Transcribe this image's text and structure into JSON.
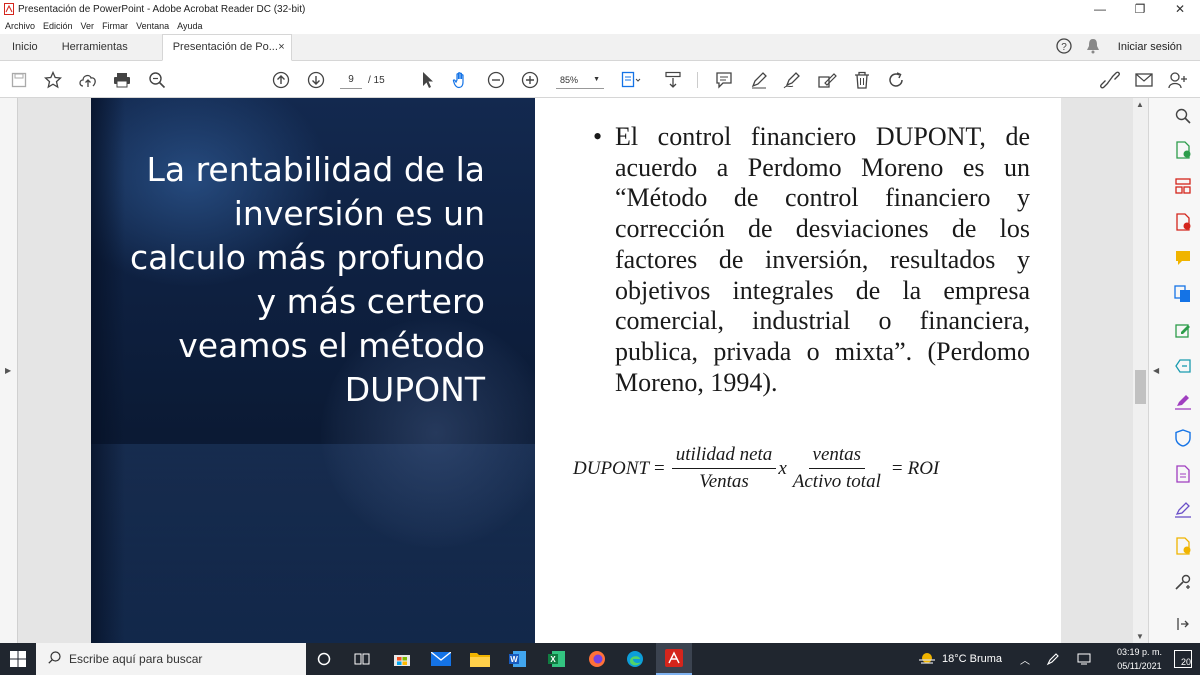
{
  "window": {
    "title": "Presentación de PowerPoint - Adobe Acrobat Reader DC (32-bit)",
    "controls": [
      "—",
      "❐",
      "✕"
    ]
  },
  "menu": [
    "Archivo",
    "Edición",
    "Ver",
    "Firmar",
    "Ventana",
    "Ayuda"
  ],
  "tabs": {
    "home": "Inicio",
    "tools": "Herramientas",
    "document": "Presentación de Po...",
    "close": "×",
    "signin": "Iniciar sesión"
  },
  "toolbar": {
    "current_page": "9",
    "page_total": "/ 15",
    "zoom": "85%"
  },
  "slide": {
    "title": "La rentabilidad de la inversión es un calculo más profundo y más certero veamos el método DUPONT",
    "bullet": "El control financiero DUPONT, de acuerdo a Perdomo Moreno es un “Método de control financiero y corrección de desviaciones de los factores de inversión, resultados y objetivos integrales de la empresa comercial, industrial o financiera, publica, privada o mixta”. (Perdomo Moreno, 1994).",
    "formula": {
      "lhs": "DUPONT",
      "eq1": "=",
      "frac1_num": "utilidad neta",
      "frac1_den": "Ventas",
      "times": "x",
      "frac2_num": "ventas",
      "frac2_den": "Activo total",
      "eq2": "=",
      "rhs": "ROI"
    }
  },
  "taskbar": {
    "search_placeholder": "Escribe aquí para buscar",
    "weather": "18°C  Bruma",
    "time": "03:19 p. m.",
    "date": "05/11/2021",
    "notifications": "20"
  },
  "colors": {
    "slide_dark": "#0e2040",
    "taskbar": "#20262f",
    "acrobat_red": "#d4251c",
    "right_pane_icon_blue": "#1473e6"
  }
}
